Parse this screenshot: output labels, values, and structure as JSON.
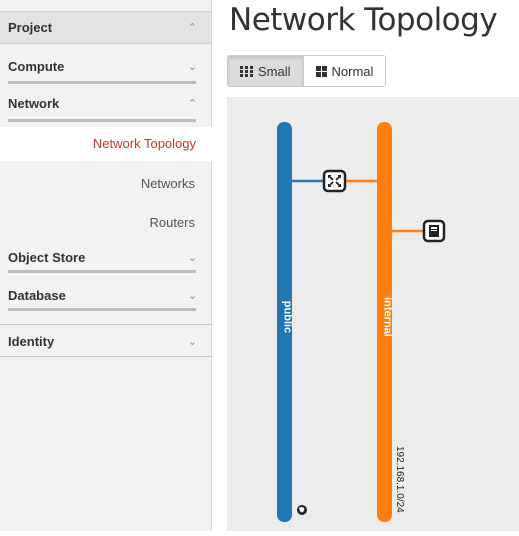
{
  "sidebar": {
    "project": "Project",
    "compute": "Compute",
    "network": "Network",
    "network_items": [
      "Network Topology",
      "Networks",
      "Routers"
    ],
    "object_store": "Object Store",
    "database": "Database",
    "identity": "Identity",
    "chevron_up": "^",
    "chevron_down": "v"
  },
  "main": {
    "title": "Network Topology",
    "view_buttons": [
      {
        "label": "Small",
        "active": true
      },
      {
        "label": "Normal",
        "active": false
      }
    ]
  },
  "topology": {
    "networks": [
      {
        "name": "public",
        "color": "#1f77b4",
        "cidr": ""
      },
      {
        "name": "internal",
        "color": "#ff7f0e",
        "cidr": "192.168.1.0/24"
      }
    ],
    "router_icon": "router-icon",
    "instance_icon": "instance-icon",
    "external_icon": "globe-icon"
  }
}
